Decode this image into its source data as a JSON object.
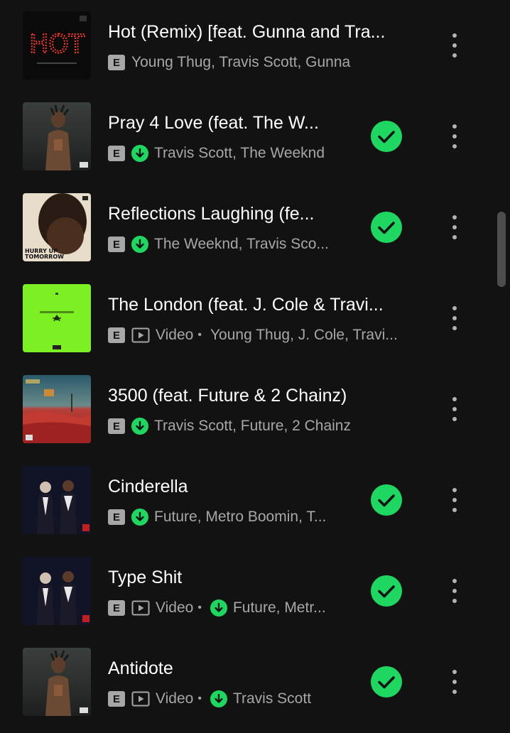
{
  "colors": {
    "background": "#121212",
    "accent_green": "#1ed760",
    "secondary_text": "#a7a7a7"
  },
  "tracks": [
    {
      "title": "Hot (Remix) [feat. Gunna and Tra...",
      "explicit_badge": "E",
      "downloaded": false,
      "has_video": false,
      "artists": "Young Thug, Travis Scott, Gunna",
      "saved": false,
      "art_text": "HOT"
    },
    {
      "title": "Pray 4 Love (feat. The W...",
      "explicit_badge": "E",
      "downloaded": true,
      "has_video": false,
      "artists": "Travis Scott, The Weeknd",
      "saved": true
    },
    {
      "title": "Reflections Laughing (fe...",
      "explicit_badge": "E",
      "downloaded": true,
      "has_video": false,
      "artists": "The Weeknd, Travis Sco...",
      "saved": true,
      "art_text_1": "HURRY UP",
      "art_text_2": "TOMORROW"
    },
    {
      "title": "The London (feat. J. Cole & Travi...",
      "explicit_badge": "E",
      "downloaded": false,
      "has_video": true,
      "video_label": "Video",
      "separator": "•",
      "artists": "Young Thug, J. Cole, Travi...",
      "saved": false
    },
    {
      "title": "3500 (feat. Future & 2 Chainz)",
      "explicit_badge": "E",
      "downloaded": true,
      "has_video": false,
      "artists": "Travis Scott, Future, 2 Chainz",
      "saved": false
    },
    {
      "title": "Cinderella",
      "explicit_badge": "E",
      "downloaded": true,
      "has_video": false,
      "artists": "Future, Metro Boomin, T...",
      "saved": true
    },
    {
      "title": "Type Shit",
      "explicit_badge": "E",
      "downloaded": true,
      "has_video": true,
      "video_label": "Video",
      "separator": "•",
      "artists": "Future, Metr...",
      "saved": true
    },
    {
      "title": "Antidote",
      "explicit_badge": "E",
      "downloaded": true,
      "has_video": true,
      "video_label": "Video",
      "separator": "•",
      "artists": "Travis Scott",
      "saved": true
    }
  ]
}
